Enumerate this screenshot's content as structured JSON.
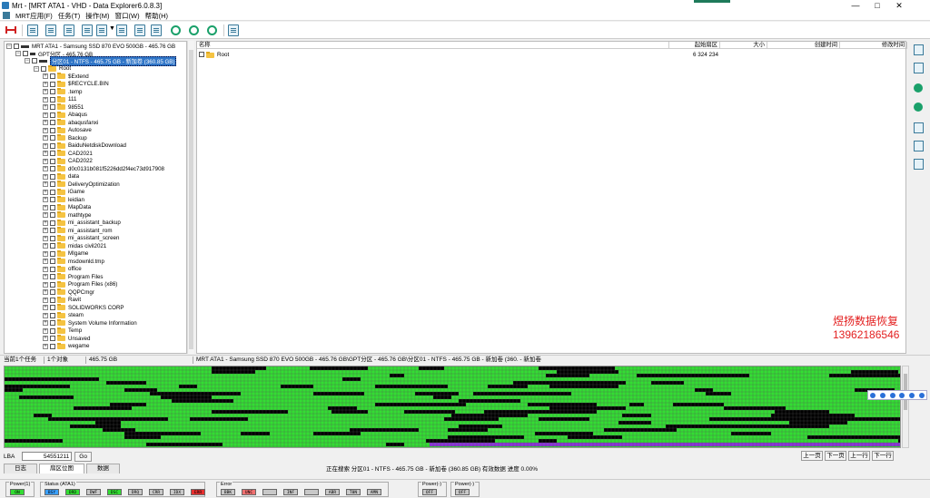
{
  "window": {
    "title": "Mrt - [MRT ATA1 - VHD - Data Explorer6.0.8.3]",
    "minimize": "—",
    "maximize": "□",
    "close": "✕"
  },
  "menu": [
    "MRT应用(F)",
    "任务(T)",
    "操作(M)",
    "窗口(W)",
    "帮助(H)"
  ],
  "tree": {
    "disk": "MRT ATA1 - Samsung SSD 870 EVO 500GB - 465.76 GB",
    "gpt": "GPT分区 - 465.76 GB",
    "partition": "分区01 - NTFS - 465.75 GB - 新加卷 (360.85 GB)",
    "root": "Root",
    "folders": [
      "$Extend",
      "$RECYCLE.BIN",
      ".temp",
      "111",
      "98551",
      "Abaqus",
      "abaqusfanxi",
      "Autosave",
      "Backup",
      "BaiduNetdiskDownload",
      "CAD2021",
      "CAD2022",
      "d0c0131b081f5226dd2f4ec73d917908",
      "data",
      "DeliveryOptimization",
      "iGame",
      "leidian",
      "MapData",
      "mathtype",
      "mi_assistant_backup",
      "mi_assistant_rom",
      "mi_assistant_screen",
      "midas civil2021",
      "MIgame",
      "msdownld.tmp",
      "office",
      "Program Files",
      "Program Files (x86)",
      "QQPCmgr",
      "Ravit",
      "SOLIDWORKS CORP",
      "steam",
      "System Volume Information",
      "Temp",
      "Unsaved",
      "wegame"
    ]
  },
  "list": {
    "columns": [
      "名称",
      "起始扇区",
      "大小",
      "创建时间",
      "修改时间"
    ],
    "rows": [
      {
        "name": "Root",
        "start": "6 324 234",
        "size": "",
        "created": "",
        "modified": ""
      }
    ]
  },
  "watermark": {
    "line1": "煜扬数据恢复",
    "line2": "13962186546"
  },
  "status": {
    "tasks": "当前1个任务",
    "objects": "1个对象",
    "size": "465.75 GB",
    "path": "MRT ATA1 - Samsung SSD 870 EVO 500GB - 465.76 GB\\GPT分区 - 465.76 GB\\分区01 - NTFS - 465.75 GB - 新加卷 (360. - 新加卷"
  },
  "map": {
    "colors": {
      "free": "#33dd33",
      "used": "#000000",
      "selected": "#8a35d8"
    }
  },
  "lba": {
    "label": "LBA",
    "value": "54551211",
    "go": "Go"
  },
  "nav": [
    "上一页",
    "下一页",
    "上一行",
    "下一行"
  ],
  "tabs": [
    "日志",
    "扇区位图",
    "数据"
  ],
  "progress": "正在搜索 分区01 - NTFS - 465.75 GB - 新加卷 (360.85 GB) 有效数据  进度 0.00%",
  "indicators": {
    "power1": {
      "label": "Power(1)",
      "leds": [
        {
          "t": "ON",
          "c": "#33dd33"
        }
      ]
    },
    "status": {
      "label": "Status (ATA1)",
      "leds": [
        {
          "t": "BSY",
          "c": "#3aa0ff"
        },
        {
          "t": "DRD",
          "c": "#33dd33"
        },
        {
          "t": "DWF",
          "c": "#c8c8c8"
        },
        {
          "t": "DSC",
          "c": "#33dd33"
        },
        {
          "t": "DRQ",
          "c": "#c8c8c8"
        },
        {
          "t": "CRR",
          "c": "#c8c8c8"
        },
        {
          "t": "IDX",
          "c": "#c8c8c8"
        },
        {
          "t": "ERR",
          "c": "#e83030"
        }
      ]
    },
    "error": {
      "label": "Error",
      "leds": [
        {
          "t": "BBK",
          "c": "#c8c8c8"
        },
        {
          "t": "UNC",
          "c": "#f07070"
        },
        {
          "t": "",
          "c": "#c8c8c8"
        },
        {
          "t": "INF",
          "c": "#c8c8c8"
        },
        {
          "t": "",
          "c": "#c8c8c8"
        },
        {
          "t": "ABR",
          "c": "#c8c8c8"
        },
        {
          "t": "T0N",
          "c": "#c8c8c8"
        },
        {
          "t": "AMN",
          "c": "#c8c8c8"
        }
      ]
    },
    "powerA": {
      "label": "Power(-)",
      "leds": [
        {
          "t": "OFF",
          "c": "#c8c8c8"
        }
      ]
    },
    "powerB": {
      "label": "Power(-)",
      "leds": [
        {
          "t": "OFF",
          "c": "#c8c8c8"
        }
      ]
    }
  }
}
